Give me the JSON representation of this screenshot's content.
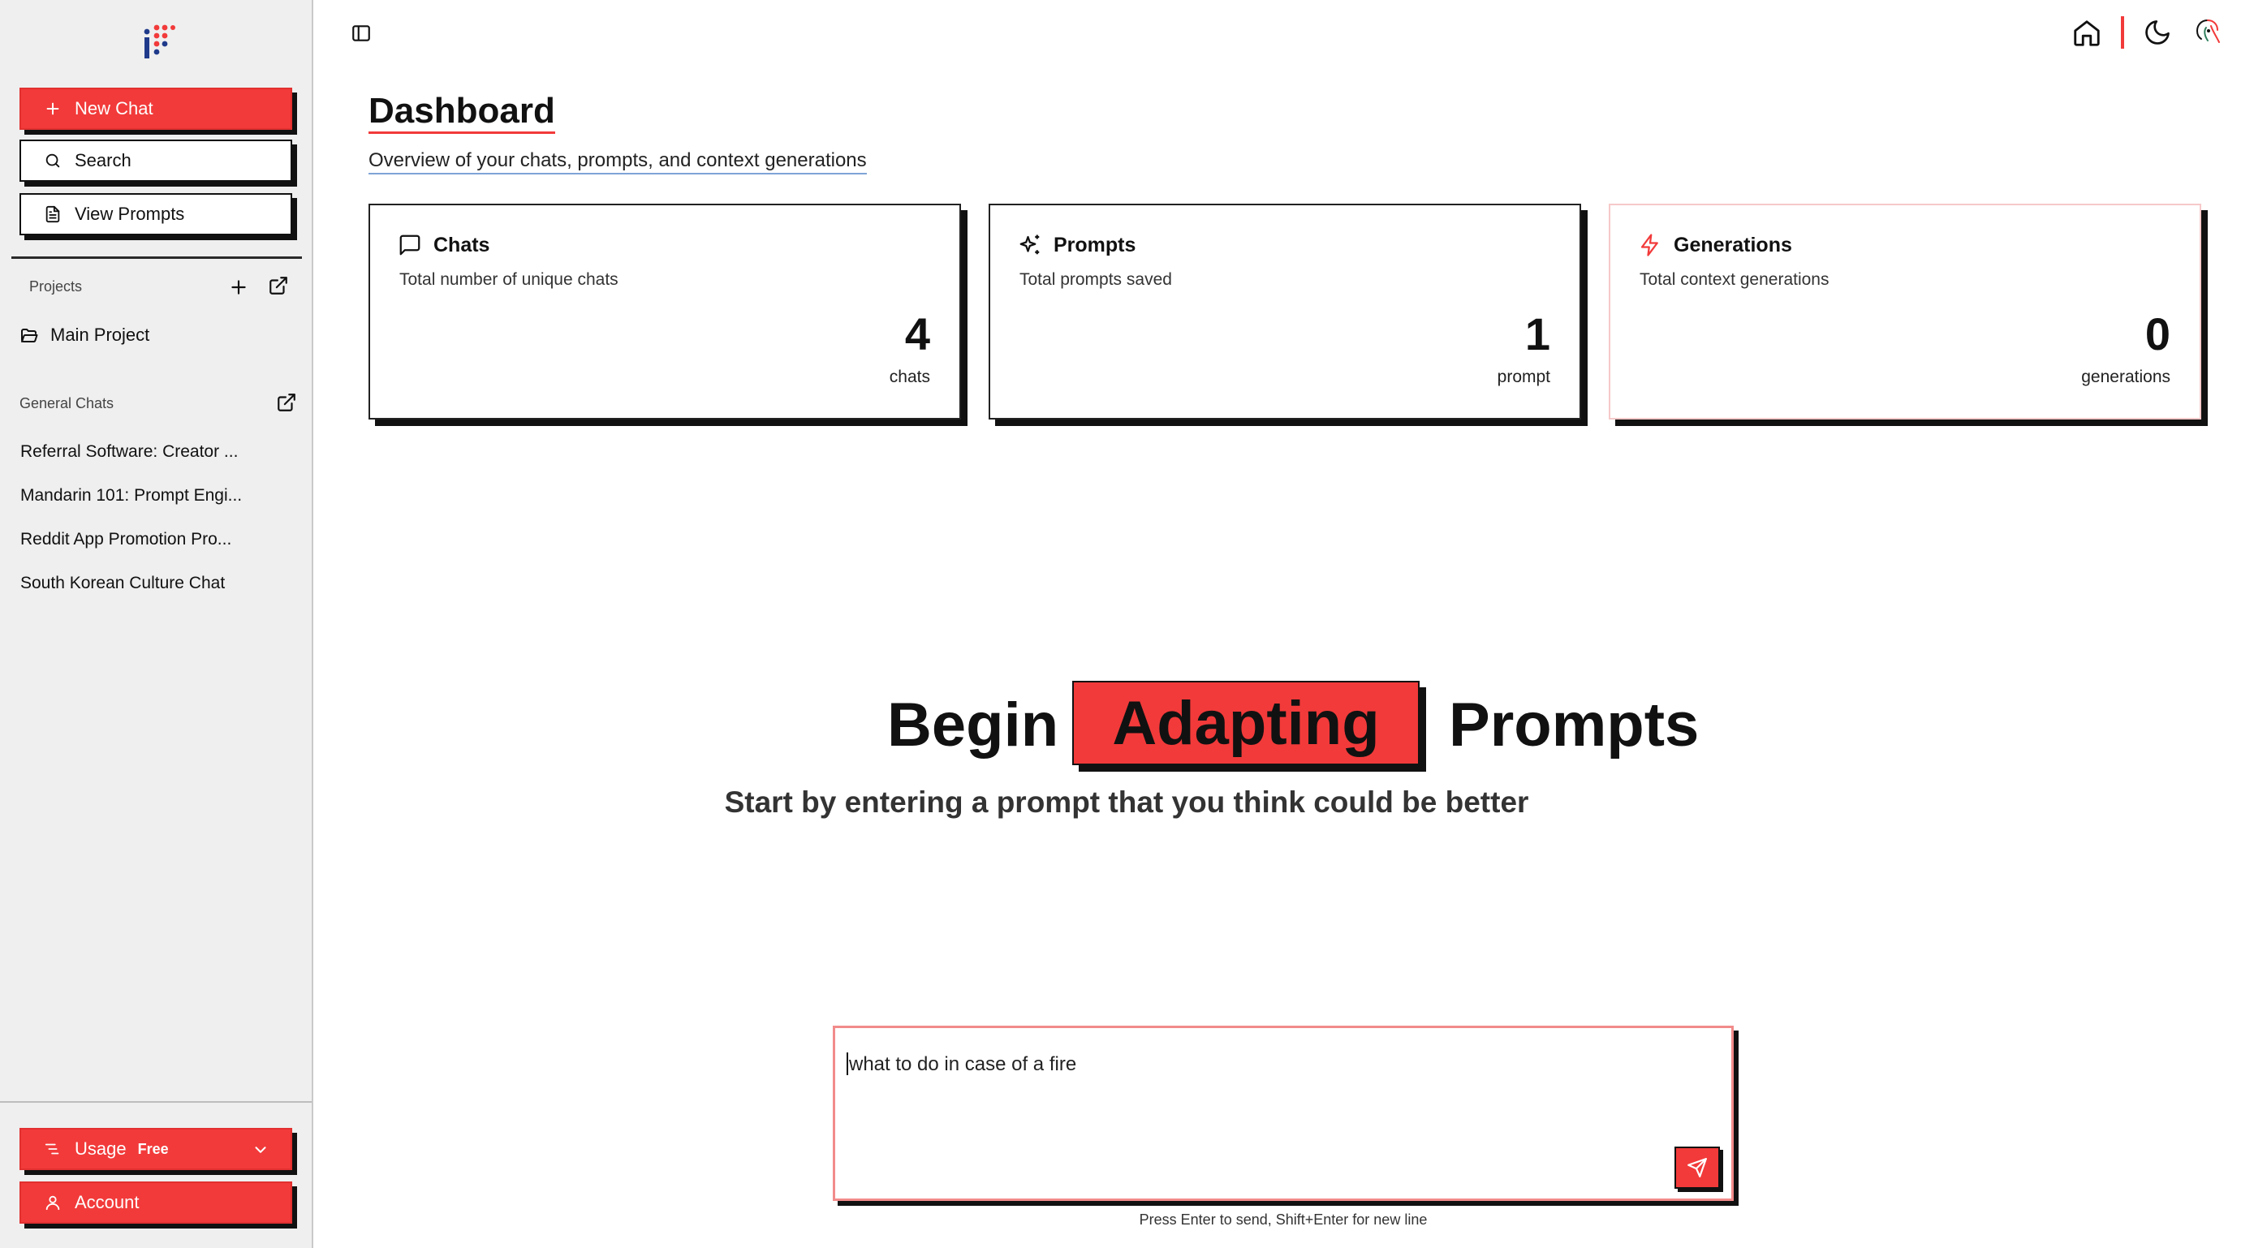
{
  "sidebar": {
    "new_chat": "New Chat",
    "search": "Search",
    "view_prompts": "View Prompts",
    "projects_label": "Projects",
    "projects": [
      {
        "label": "Main Project"
      }
    ],
    "general_chats_label": "General Chats",
    "chats": [
      {
        "label": "Referral Software: Creator ..."
      },
      {
        "label": "Mandarin 101: Prompt Engi..."
      },
      {
        "label": "Reddit App Promotion Pro..."
      },
      {
        "label": "South Korean Culture Chat"
      }
    ],
    "usage_label": "Usage",
    "usage_plan": "Free",
    "account_label": "Account"
  },
  "header": {
    "title": "Dashboard",
    "subtitle": "Overview of your chats, prompts, and context generations"
  },
  "cards": [
    {
      "title": "Chats",
      "description": "Total number of unique chats",
      "value": "4",
      "unit": "chats",
      "icon": "message-square-icon"
    },
    {
      "title": "Prompts",
      "description": "Total prompts saved",
      "value": "1",
      "unit": "prompt",
      "icon": "sparkles-icon"
    },
    {
      "title": "Generations",
      "description": "Total context generations",
      "value": "0",
      "unit": "generations",
      "icon": "zap-icon"
    }
  ],
  "hero": {
    "word1": "Begin",
    "highlight": "Adapting",
    "word3": "Prompts",
    "subtitle": "Start by entering a prompt that you think could be better"
  },
  "prompt_input": {
    "value": "what to do in case of a fire",
    "hint": "Press Enter to send, Shift+Enter for new line"
  },
  "colors": {
    "accent": "#f23a3a",
    "sidebar_bg": "#efefef",
    "shadow": "#111111"
  }
}
